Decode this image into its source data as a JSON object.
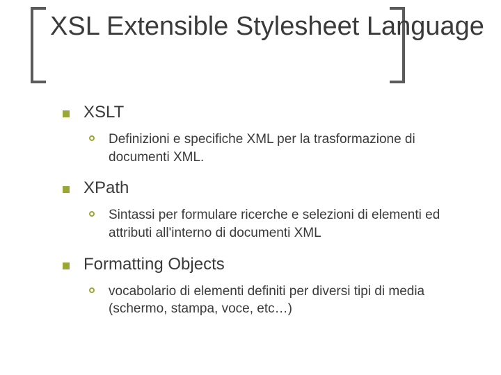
{
  "title": "XSL Extensible Stylesheet Language",
  "items": [
    {
      "label": "XSLT",
      "sub": [
        "Definizioni e specifiche XML per la trasformazione di documenti XML."
      ]
    },
    {
      "label": "XPath",
      "sub": [
        "Sintassi per formulare ricerche e selezioni di elementi ed attributi all'interno di documenti XML"
      ]
    },
    {
      "label": "Formatting Objects",
      "sub": [
        "vocabolario di elementi definiti per diversi tipi di media (schermo, stampa, voce, etc…)"
      ]
    }
  ]
}
